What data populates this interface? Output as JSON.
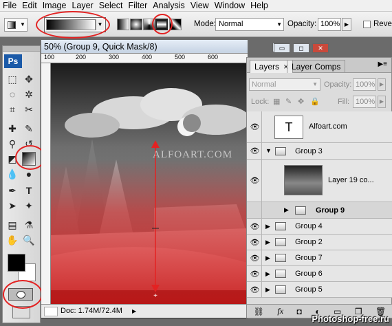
{
  "menu": [
    "File",
    "Edit",
    "Image",
    "Layer",
    "Select",
    "Filter",
    "Analysis",
    "View",
    "Window",
    "Help"
  ],
  "options": {
    "mode_label": "Mode:",
    "mode_value": "Normal",
    "opacity_label": "Opacity:",
    "opacity_value": "100%",
    "reverse_label": "Rever"
  },
  "document": {
    "title": "50% (Group 9, Quick Mask/8)",
    "ruler_ticks": [
      "100",
      "200",
      "300",
      "400",
      "500",
      "600"
    ],
    "status": "Doc: 1.74M/72.4M",
    "watermark_text": "ALFOART.COM"
  },
  "tools": {
    "ps_logo": "Ps"
  },
  "layers_panel": {
    "tab_layers": "Layers",
    "tab_close": "×",
    "tab_layer_comps": "Layer Comps",
    "blend_mode": "Normal",
    "opacity_label": "Opacity:",
    "opacity_value": "100%",
    "lock_label": "Lock:",
    "fill_label": "Fill:",
    "fill_value": "100%",
    "text_thumb": "T",
    "rows": [
      {
        "name": "Alfoart.com"
      },
      {
        "name": "Group 3"
      },
      {
        "name": "Layer 19 co..."
      },
      {
        "name": "Group 9"
      },
      {
        "name": "Group 4"
      },
      {
        "name": "Group 2"
      },
      {
        "name": "Group 7"
      },
      {
        "name": "Group 6"
      },
      {
        "name": "Group 5"
      }
    ]
  },
  "site_watermark": "Photoshop-free.ru",
  "colors": {
    "annotation": "#e32222",
    "selected_row": "#d6d6d6",
    "mask_red": "#e11e1e"
  }
}
